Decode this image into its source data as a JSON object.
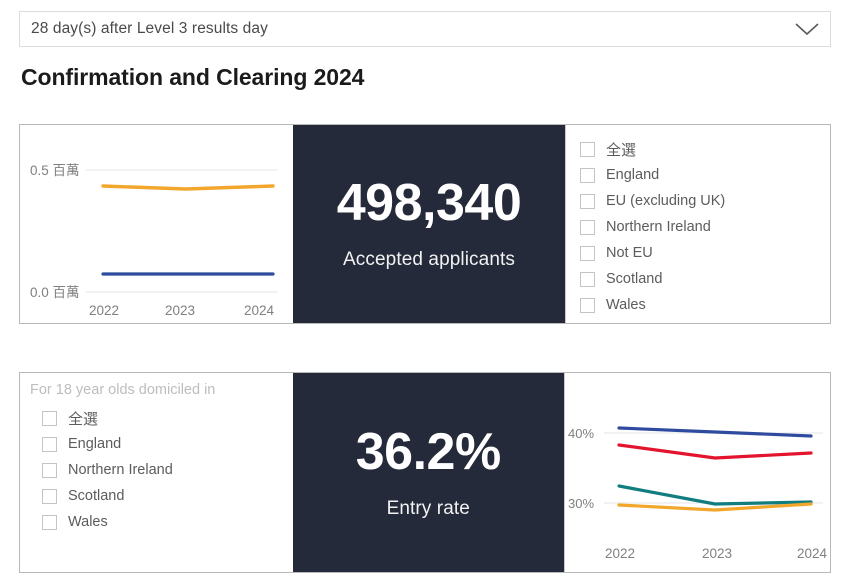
{
  "filter_bar": {
    "selected_value": "28 day(s) after Level 3 results day",
    "chevron_icon": "chevron-down-icon"
  },
  "page_title": "Confirmation and Clearing 2024",
  "colors": {
    "panel_dark": "#242a39",
    "series_orange": "#f2a72c",
    "series_navy": "#2e4c9e",
    "series_blue": "#2f4ba0",
    "series_red": "#e3142d",
    "series_teal": "#127d7f",
    "gridline": "#ededed",
    "axis_text": "#808080",
    "card_border": "#b8b8b8"
  },
  "card_top": {
    "kpi": {
      "value": "498,340",
      "label": "Accepted applicants"
    },
    "filter_list": {
      "heading": "",
      "items": [
        {
          "label": "全選",
          "checked": false
        },
        {
          "label": "England",
          "checked": false
        },
        {
          "label": "EU (excluding UK)",
          "checked": false
        },
        {
          "label": "Northern Ireland",
          "checked": false
        },
        {
          "label": "Not EU",
          "checked": false
        },
        {
          "label": "Scotland",
          "checked": false
        },
        {
          "label": "Wales",
          "checked": false
        }
      ]
    }
  },
  "card_bottom": {
    "kpi": {
      "value": "36.2%",
      "label": "Entry rate"
    },
    "filter_list": {
      "heading": "For 18 year olds domiciled in",
      "items": [
        {
          "label": "全選",
          "checked": false
        },
        {
          "label": "England",
          "checked": false
        },
        {
          "label": "Northern Ireland",
          "checked": false
        },
        {
          "label": "Scotland",
          "checked": false
        },
        {
          "label": "Wales",
          "checked": false
        }
      ]
    }
  },
  "chart_data": [
    {
      "id": "accepted-applicants-trend",
      "type": "line",
      "title": "",
      "xlabel": "",
      "ylabel": "",
      "x": [
        "2022",
        "2023",
        "2024"
      ],
      "categories": [
        "2022",
        "2023",
        "2024"
      ],
      "ytick_labels": [
        "0.0 百萬",
        "0.5 百萬"
      ],
      "ytick_values": [
        0.0,
        0.5
      ],
      "ylim": [
        0.0,
        0.5
      ],
      "yunit": "百萬",
      "grid": true,
      "legend": "none",
      "series": [
        {
          "name": "series-orange",
          "color": "#f2a72c",
          "values": [
            0.434,
            0.425,
            0.432
          ]
        },
        {
          "name": "series-navy",
          "color": "#2e4c9e",
          "values": [
            0.072,
            0.072,
            0.073
          ]
        }
      ]
    },
    {
      "id": "entry-rate-trend",
      "type": "line",
      "title": "",
      "xlabel": "",
      "ylabel": "",
      "x": [
        "2022",
        "2023",
        "2024"
      ],
      "categories": [
        "2022",
        "2023",
        "2024"
      ],
      "ytick_labels": [
        "30%",
        "40%"
      ],
      "ytick_values": [
        30,
        40
      ],
      "ylim": [
        26,
        43
      ],
      "yunit": "%",
      "grid": true,
      "legend": "none",
      "series": [
        {
          "name": "series-blue",
          "color": "#2f4ba0",
          "values": [
            40.7,
            40.2,
            39.6
          ]
        },
        {
          "name": "series-red",
          "color": "#e3142d",
          "values": [
            38.3,
            36.5,
            37.1
          ]
        },
        {
          "name": "series-teal",
          "color": "#127d7f",
          "values": [
            32.5,
            30.0,
            30.2
          ]
        },
        {
          "name": "series-orange",
          "color": "#f2a72c",
          "values": [
            29.8,
            29.0,
            30.0
          ]
        }
      ]
    }
  ]
}
